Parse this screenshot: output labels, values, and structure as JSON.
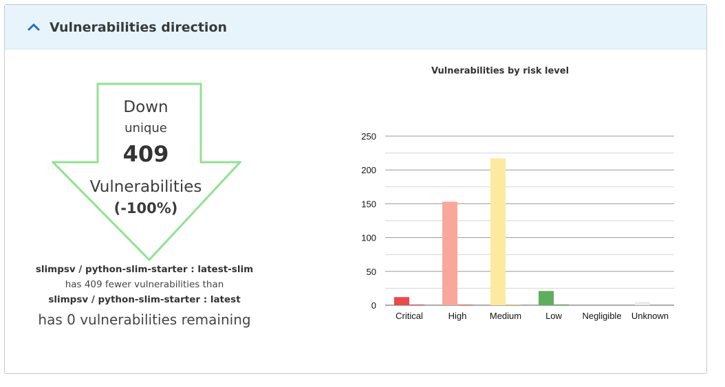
{
  "header": {
    "title": "Vulnerabilities direction",
    "toggle_icon": "chevron-up-icon"
  },
  "direction": {
    "label": "Down",
    "sublabel": "unique",
    "count": "409",
    "unit": "Vulnerabilities",
    "percent": "(-100%)",
    "arrow_color": "#90e290"
  },
  "description": {
    "image_a": "slimpsv / python-slim-starter : latest-slim",
    "comparison": "has 409 fewer vulnerabilities than",
    "image_b": "slimpsv / python-slim-starter : latest",
    "remaining": "has 0 vulnerabilities remaining"
  },
  "chart_data": {
    "type": "bar",
    "title": "Vulnerabilities by risk level",
    "categories": [
      "Critical",
      "High",
      "Medium",
      "Low",
      "Negligible",
      "Unknown"
    ],
    "series": [
      {
        "values": [
          12,
          153,
          217,
          21,
          0,
          5
        ],
        "colors": [
          "#e84a4a",
          "#f9a79a",
          "#fde9a0",
          "#5fae5b",
          "#b9b9b9",
          "#ececec"
        ]
      },
      {
        "values": [
          1,
          1,
          1,
          1,
          0,
          0
        ],
        "colors": [
          "#d64c4c",
          "#d66c5c",
          "#d8c06c",
          "#4f9a4b",
          "#b9b9b9",
          "#dddddd"
        ]
      }
    ],
    "y_ticks": [
      "0",
      "50",
      "100",
      "150",
      "200",
      "250"
    ],
    "ylim": [
      0,
      250
    ],
    "grid": true
  }
}
